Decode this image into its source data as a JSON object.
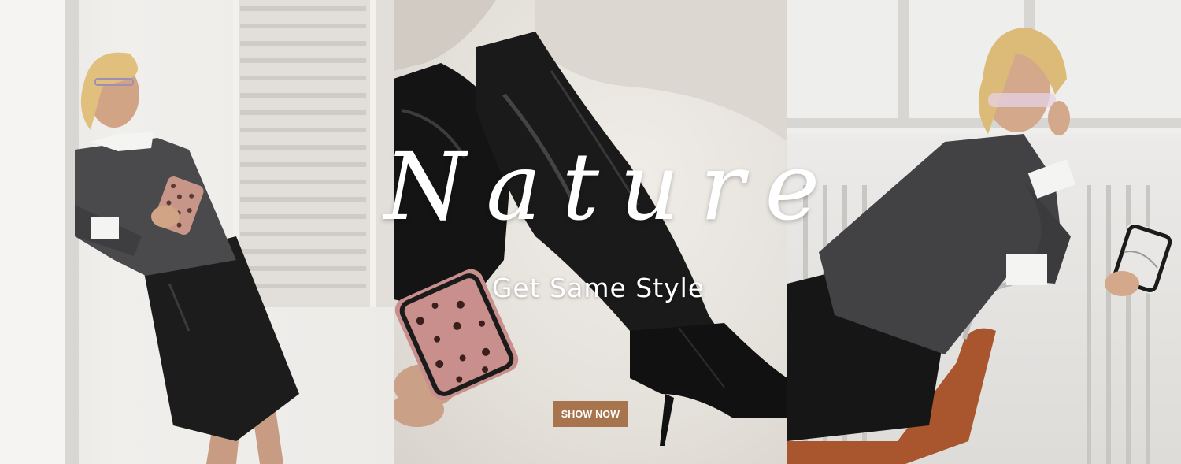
{
  "banner": {
    "headline": "Nature",
    "subheadline": "Get Same Style",
    "cta_label": "SHOW NOW"
  },
  "colors": {
    "cta_background": "#a8744e",
    "headline_text": "#ffffff",
    "leopard_case": "#c98f8c"
  }
}
